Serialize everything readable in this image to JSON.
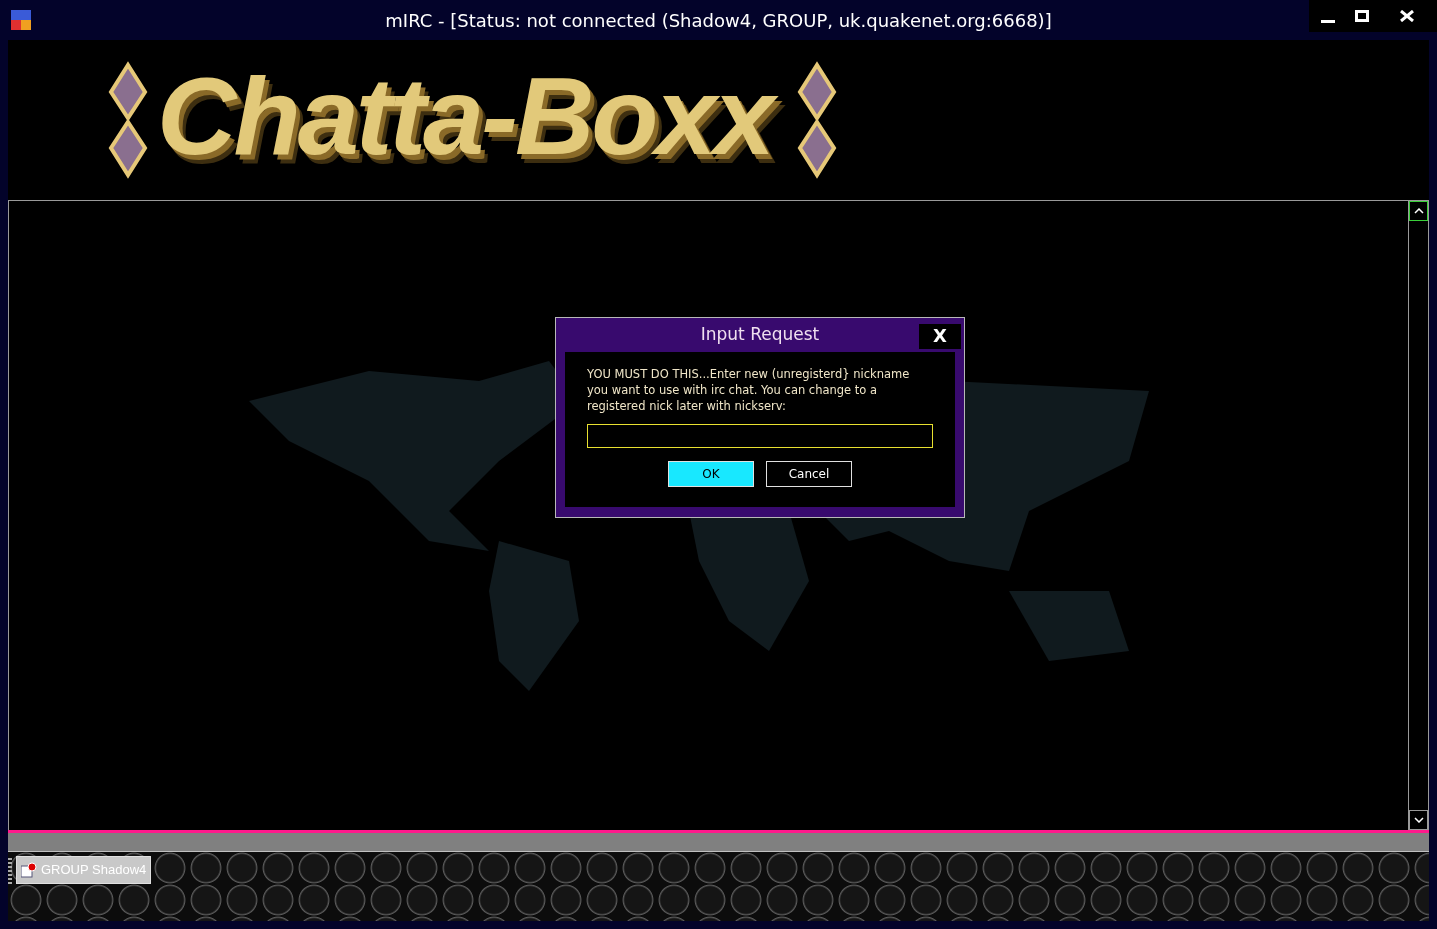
{
  "window": {
    "title": "mIRC - [Status: not connected (Shadow4, GROUP, uk.quakenet.org:6668)]"
  },
  "banner": {
    "text": "Chatta-Boxx"
  },
  "dialog": {
    "title": "Input Request",
    "close": "X",
    "message": "YOU MUST DO THIS...Enter new (unregisterd} nickname you want to use with irc chat. You can change to a registered nick later with nickserv:",
    "buttons": [
      {
        "label": "OK",
        "kind": "default"
      },
      {
        "label": "Cancel",
        "kind": "normal"
      }
    ]
  },
  "switchbar": {
    "items": [
      {
        "label": "GROUP Shadow4"
      }
    ]
  }
}
